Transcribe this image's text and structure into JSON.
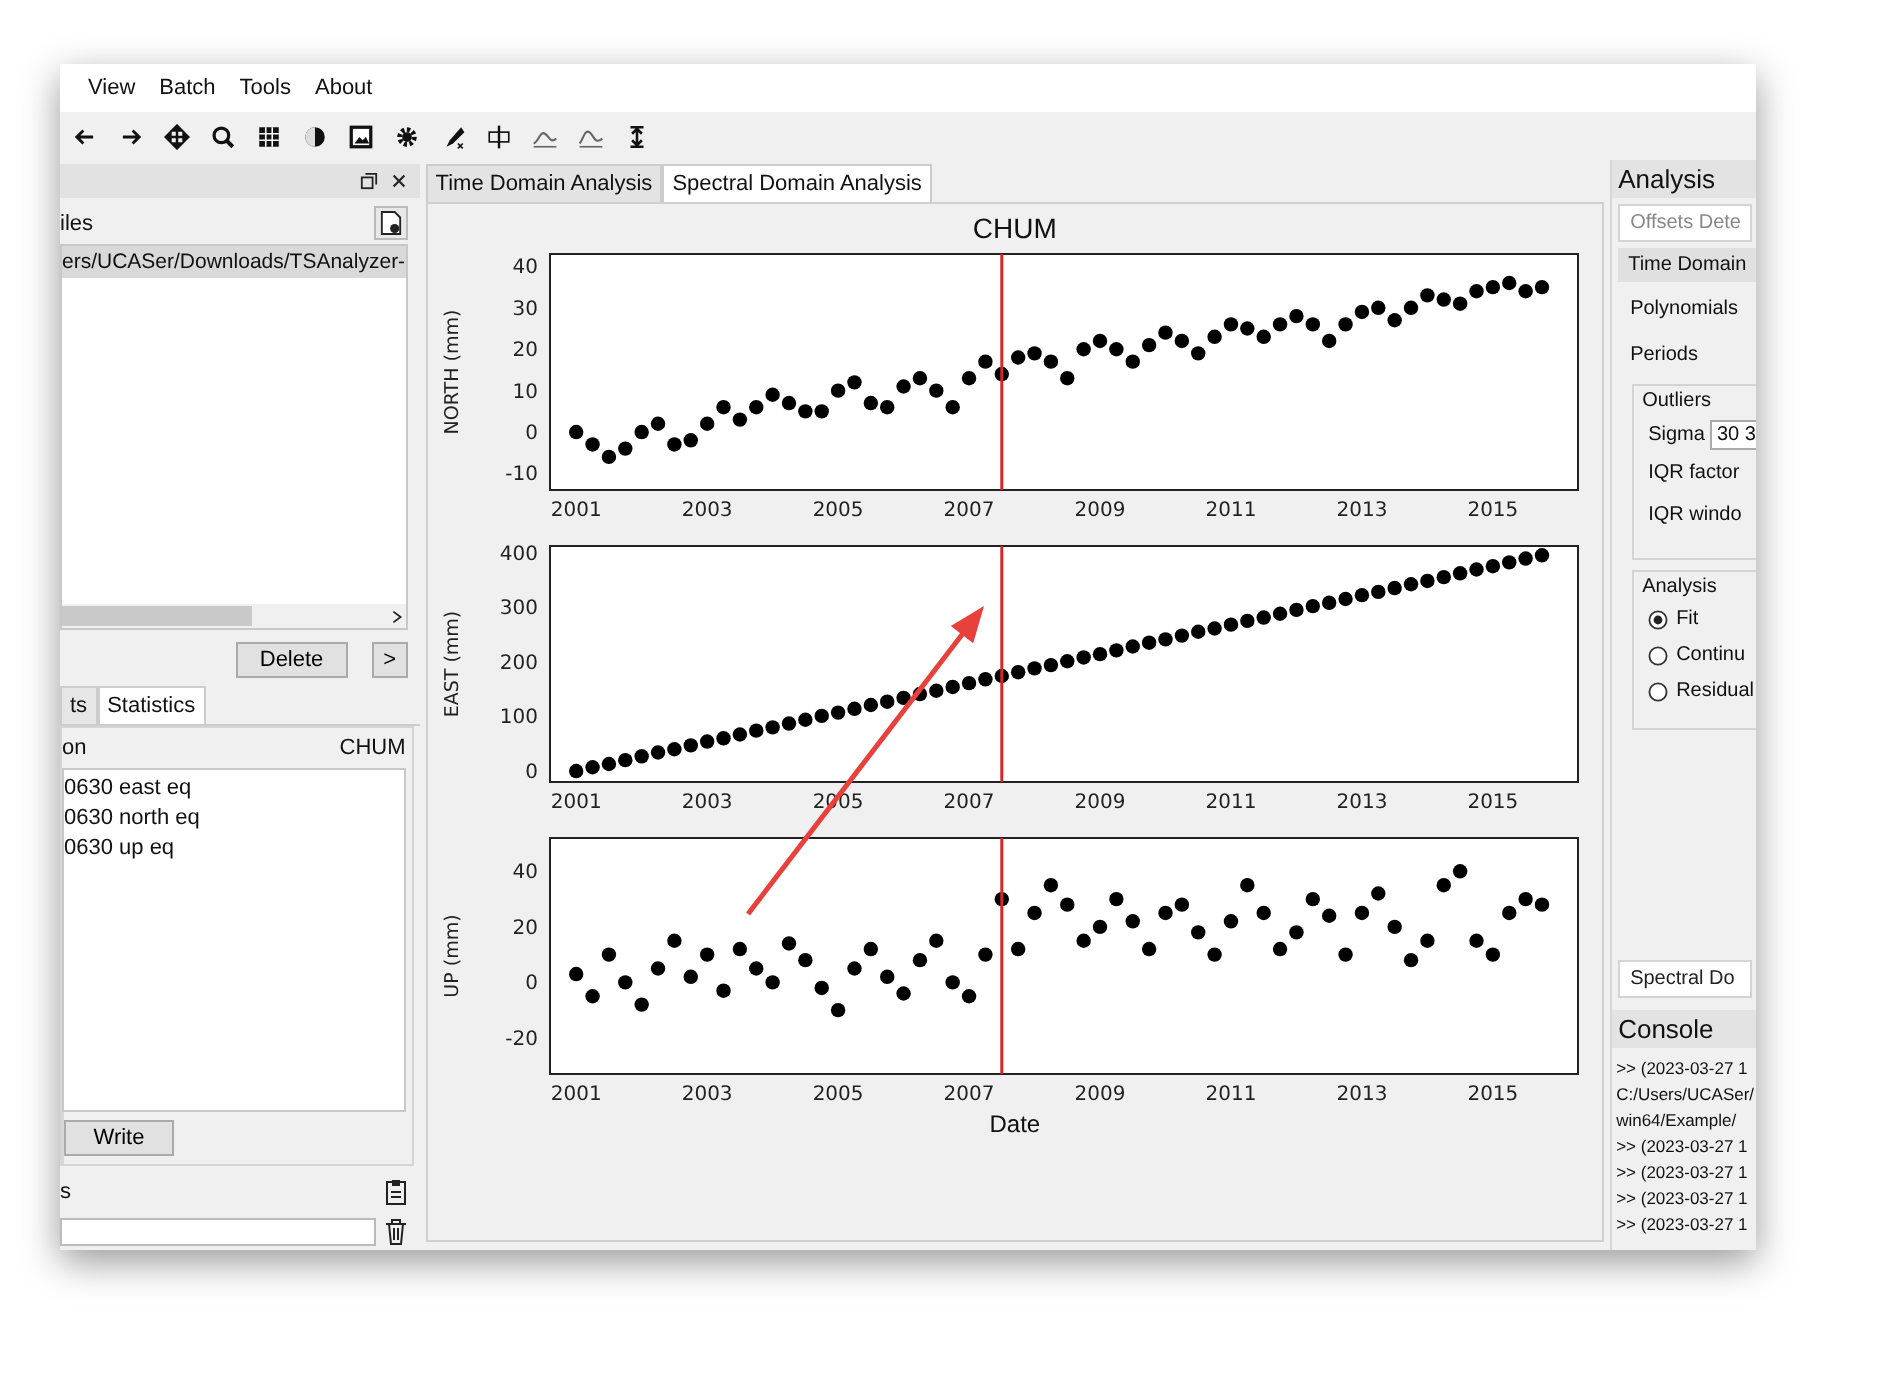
{
  "menu": [
    {
      "label": "View"
    },
    {
      "label": "Batch"
    },
    {
      "label": "Tools"
    },
    {
      "label": "About"
    }
  ],
  "left_panel": {
    "files_label": "iles",
    "file_list": [
      {
        "text": "ers/UCASer/Downloads/TSAnalyzer-",
        "selected": true
      }
    ],
    "delete_button": "Delete",
    "next_button": ">",
    "tabs": [
      {
        "label": "ts",
        "selected": false
      },
      {
        "label": "Statistics",
        "selected": true
      }
    ],
    "stats_header": {
      "column_1": "on",
      "column_2": "CHUM"
    },
    "stats_items": [
      "0630 east eq",
      "0630 north eq",
      "0630 up eq"
    ],
    "write_button": "Write",
    "notes_label": "s"
  },
  "center": {
    "tabs": [
      {
        "label": "Time Domain Analysis",
        "selected": false
      },
      {
        "label": "Spectral Domain Analysis",
        "selected": true
      }
    ],
    "markup": [
      {
        "kind": "arrow"
      }
    ],
    "charts": [
      {
        "chart_data": {
          "type": "scatter",
          "title": "CHUM",
          "ylabel": "NORTH (mm)",
          "xlim": [
            2000.6,
            2016.3
          ],
          "ylim": [
            -14,
            43
          ],
          "xticks": [
            2001,
            2003,
            2005,
            2007,
            2009,
            2011,
            2013,
            2015
          ],
          "yticks": [
            -10,
            0,
            10,
            20,
            30,
            40
          ],
          "ref_lines": [
            {
              "axis": "x",
              "value": 2007.5,
              "color": "#d62728"
            }
          ],
          "x": [
            2001,
            2001.25,
            2001.5,
            2001.75,
            2002,
            2002.25,
            2002.5,
            2002.75,
            2003,
            2003.25,
            2003.5,
            2003.75,
            2004,
            2004.25,
            2004.5,
            2004.75,
            2005,
            2005.25,
            2005.5,
            2005.75,
            2006,
            2006.25,
            2006.5,
            2006.75,
            2007,
            2007.25,
            2007.5,
            2007.75,
            2008,
            2008.25,
            2008.5,
            2008.75,
            2009,
            2009.25,
            2009.5,
            2009.75,
            2010,
            2010.25,
            2010.5,
            2010.75,
            2011,
            2011.25,
            2011.5,
            2011.75,
            2012,
            2012.25,
            2012.5,
            2012.75,
            2013,
            2013.25,
            2013.5,
            2013.75,
            2014,
            2014.25,
            2014.5,
            2014.75,
            2015,
            2015.25,
            2015.5,
            2015.75
          ],
          "series": [
            {
              "color": "#000000",
              "values": [
                0,
                -3,
                -6,
                -4,
                0,
                2,
                -3,
                -2,
                2,
                6,
                3,
                6,
                9,
                7,
                5,
                5,
                10,
                12,
                7,
                6,
                11,
                13,
                10,
                6,
                13,
                17,
                14,
                18,
                19,
                17,
                13,
                20,
                22,
                20,
                17,
                21,
                24,
                22,
                19,
                23,
                26,
                25,
                23,
                26,
                28,
                26,
                22,
                26,
                29,
                30,
                27,
                30,
                33,
                32,
                31,
                34,
                35,
                36,
                34,
                35
              ]
            }
          ]
        }
      },
      {
        "chart_data": {
          "type": "scatter",
          "ylabel": "EAST (mm)",
          "xlim": [
            2000.6,
            2016.3
          ],
          "ylim": [
            -20,
            412
          ],
          "xticks": [
            2001,
            2003,
            2005,
            2007,
            2009,
            2011,
            2013,
            2015
          ],
          "yticks": [
            0,
            100,
            200,
            300,
            400
          ],
          "ref_lines": [
            {
              "axis": "x",
              "value": 2007.5,
              "color": "#d62728"
            }
          ],
          "x": [
            2001,
            2001.25,
            2001.5,
            2001.75,
            2002,
            2002.25,
            2002.5,
            2002.75,
            2003,
            2003.25,
            2003.5,
            2003.75,
            2004,
            2004.25,
            2004.5,
            2004.75,
            2005,
            2005.25,
            2005.5,
            2005.75,
            2006,
            2006.25,
            2006.5,
            2006.75,
            2007,
            2007.25,
            2007.5,
            2007.75,
            2008,
            2008.25,
            2008.5,
            2008.75,
            2009,
            2009.25,
            2009.5,
            2009.75,
            2010,
            2010.25,
            2010.5,
            2010.75,
            2011,
            2011.25,
            2011.5,
            2011.75,
            2012,
            2012.25,
            2012.5,
            2012.75,
            2013,
            2013.25,
            2013.5,
            2013.75,
            2014,
            2014.25,
            2014.5,
            2014.75,
            2015,
            2015.25,
            2015.5,
            2015.75
          ],
          "series": [
            {
              "color": "#000000",
              "values": [
                0,
                7,
                13,
                20,
                27,
                34,
                40,
                47,
                54,
                60,
                67,
                74,
                80,
                87,
                94,
                101,
                107,
                114,
                121,
                127,
                134,
                141,
                147,
                154,
                161,
                168,
                174,
                181,
                188,
                194,
                201,
                208,
                214,
                221,
                228,
                235,
                241,
                248,
                255,
                261,
                268,
                275,
                281,
                288,
                295,
                302,
                308,
                315,
                322,
                328,
                335,
                342,
                348,
                355,
                362,
                369,
                375,
                382,
                389,
                395
              ]
            }
          ]
        }
      },
      {
        "chart_data": {
          "type": "scatter",
          "xlabel": "Date",
          "ylabel": "UP (mm)",
          "xlim": [
            2000.6,
            2016.3
          ],
          "ylim": [
            -33,
            52
          ],
          "xticks": [
            2001,
            2003,
            2005,
            2007,
            2009,
            2011,
            2013,
            2015
          ],
          "yticks": [
            -20,
            0,
            20,
            40
          ],
          "ref_lines": [
            {
              "axis": "x",
              "value": 2007.5,
              "color": "#d62728"
            }
          ],
          "x": [
            2001,
            2001.25,
            2001.5,
            2001.75,
            2002,
            2002.25,
            2002.5,
            2002.75,
            2003,
            2003.25,
            2003.5,
            2003.75,
            2004,
            2004.25,
            2004.5,
            2004.75,
            2005,
            2005.25,
            2005.5,
            2005.75,
            2006,
            2006.25,
            2006.5,
            2006.75,
            2007,
            2007.25,
            2007.5,
            2007.75,
            2008,
            2008.25,
            2008.5,
            2008.75,
            2009,
            2009.25,
            2009.5,
            2009.75,
            2010,
            2010.25,
            2010.5,
            2010.75,
            2011,
            2011.25,
            2011.5,
            2011.75,
            2012,
            2012.25,
            2012.5,
            2012.75,
            2013,
            2013.25,
            2013.5,
            2013.75,
            2014,
            2014.25,
            2014.5,
            2014.75,
            2015,
            2015.25,
            2015.5,
            2015.75
          ],
          "series": [
            {
              "color": "#000000",
              "values": [
                3,
                -5,
                10,
                0,
                -8,
                5,
                15,
                2,
                10,
                -3,
                12,
                5,
                0,
                14,
                8,
                -2,
                -10,
                5,
                12,
                2,
                -4,
                8,
                15,
                0,
                -5,
                10,
                30,
                12,
                25,
                35,
                28,
                15,
                20,
                30,
                22,
                12,
                25,
                28,
                18,
                10,
                22,
                35,
                25,
                12,
                18,
                30,
                24,
                10,
                25,
                32,
                20,
                8,
                15,
                35,
                40,
                15,
                10,
                25,
                30,
                28
              ]
            }
          ]
        }
      }
    ]
  },
  "right_panel": {
    "title": "Analysis",
    "offsets_field": "Offsets Dete",
    "time_domain_tab": "Time Domain",
    "labels": [
      "Polynomials",
      "Periods"
    ],
    "outliers": {
      "title": "Outliers",
      "sigma_label": "Sigma",
      "sigma_value": "30 3",
      "iqr_factor_label": "IQR factor",
      "iqr_window_label": "IQR windo"
    },
    "analysis": {
      "title": "Analysis",
      "options": [
        {
          "label": "Fit",
          "selected": true
        },
        {
          "label": "Continu",
          "selected": false
        },
        {
          "label": "Residual",
          "selected": false
        }
      ]
    },
    "spectral_button": "Spectral Do",
    "console": {
      "title": "Console",
      "lines": [
        ">> (2023-03-27 1",
        "C:/Users/UCASer/",
        "win64/Example/",
        ">> (2023-03-27 1",
        ">> (2023-03-27 1",
        ">> (2023-03-27 1",
        ">> (2023-03-27 1"
      ]
    }
  }
}
